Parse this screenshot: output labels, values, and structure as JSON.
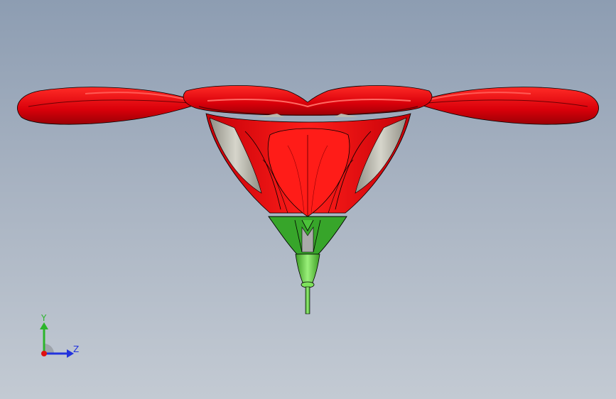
{
  "viewport": {
    "background_top": "#8d9db2",
    "background_bottom": "#c3cad3"
  },
  "model": {
    "petal_color": "#e0000a",
    "petal_dark": "#9a0006",
    "petal_highlight": "#ff3a36",
    "interior_color": "#b9b8ad",
    "sepal_color": "#37a52a",
    "stem_color": "#6fde4f"
  },
  "triad": {
    "y_label": "Y",
    "z_label": "Z",
    "y_color": "#2bb52b",
    "z_color": "#2233dd",
    "x_color": "#e01010"
  }
}
